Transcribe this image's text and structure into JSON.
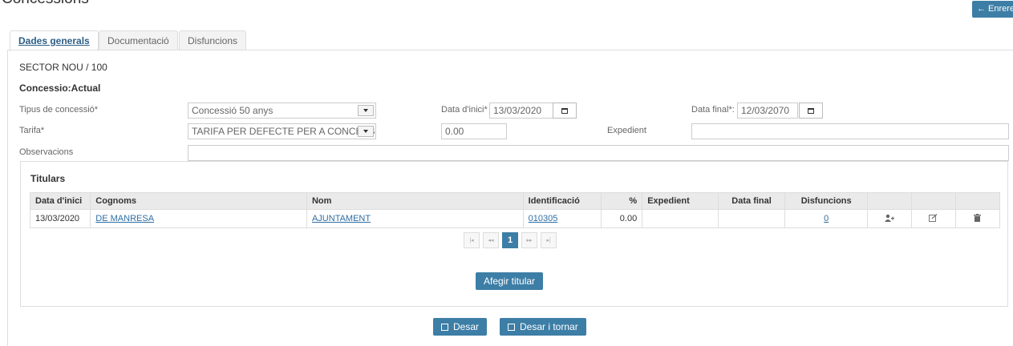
{
  "page": {
    "title": "Concessions",
    "back_label": "← Enrere"
  },
  "tabs": [
    {
      "label": "Dades generals",
      "active": true
    },
    {
      "label": "Documentació",
      "active": false
    },
    {
      "label": "Disfuncions",
      "active": false
    }
  ],
  "header": {
    "sector": "SECTOR NOU / 100",
    "concessio": "Concessio:Actual"
  },
  "form": {
    "tipus_label": "Tipus de concessió*",
    "tipus_value": "Concessió 50 anys",
    "data_inici_label": "Data d'inici*",
    "data_inici_value": "13/03/2020",
    "data_final_label": "Data final*:",
    "data_final_value": "12/03/2070",
    "tarifa_label": "Tarifa*",
    "tarifa_value": "TARIFA PER DEFECTE PER A CONCESSIÓ",
    "import_value": "0.00",
    "expedient_label": "Expedient",
    "expedient_value": "",
    "observacions_label": "Observacions",
    "observacions_value": ""
  },
  "titulars": {
    "title": "Titulars",
    "columns": [
      "Data d'inici",
      "Cognoms",
      "Nom",
      "Identificació",
      "%",
      "Expedient",
      "Data final",
      "Disfuncions"
    ],
    "rows": [
      {
        "data_inici": "13/03/2020",
        "cognoms": "DE MANRESA",
        "nom": "AJUNTAMENT",
        "identificacio": "010305",
        "percent": "0.00",
        "expedient": "",
        "data_final": "",
        "disfuncions": "0"
      }
    ],
    "pager": {
      "first": "|◂",
      "prev": "◂◂",
      "current": "1",
      "next": "▸▸",
      "last": "▸|"
    },
    "add_label": "Afegir titular"
  },
  "actions": {
    "save_label": "Desar",
    "save_return_label": "Desar i tornar"
  },
  "colors": {
    "primary": "#3d7ea6",
    "link": "#2f6ea3",
    "header_bg": "#eaeaea",
    "border": "#dddddd"
  }
}
